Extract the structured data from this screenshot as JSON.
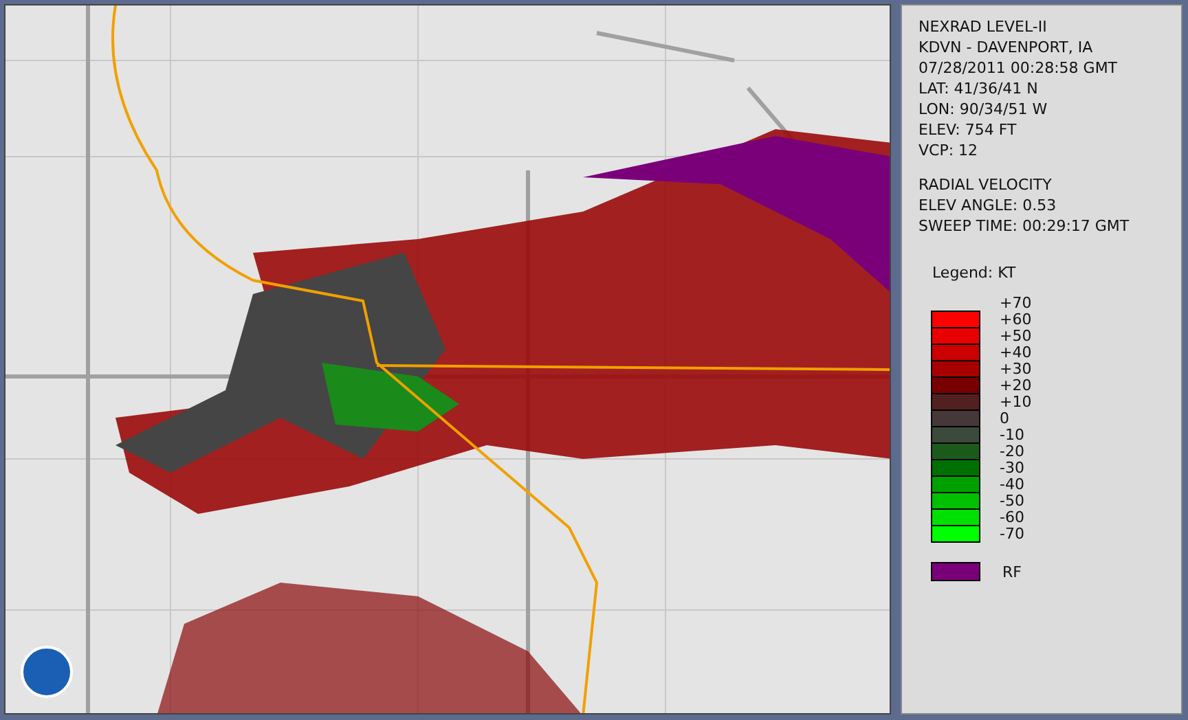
{
  "info_panel": {
    "station_lines": [
      "NEXRAD LEVEL-II",
      "KDVN - DAVENPORT, IA",
      "07/28/2011 00:28:58 GMT",
      "LAT: 41/36/41 N",
      "LON: 90/34/51 W",
      "ELEV: 754 FT",
      "VCP: 12"
    ],
    "product_lines": [
      "RADIAL VELOCITY",
      "ELEV ANGLE: 0.53",
      "SWEEP TIME: 00:29:17 GMT"
    ],
    "legend": {
      "title": "Legend: KT",
      "swatches": [
        {
          "color": "#ff0000"
        },
        {
          "color": "#e80000"
        },
        {
          "color": "#cc0000"
        },
        {
          "color": "#a80000"
        },
        {
          "color": "#780000"
        },
        {
          "color": "#522020"
        },
        {
          "color": "#463838"
        },
        {
          "color": "#3c4a3c"
        },
        {
          "color": "#1c5a1c"
        },
        {
          "color": "#007000"
        },
        {
          "color": "#00a000"
        },
        {
          "color": "#00c000"
        },
        {
          "color": "#00e000"
        },
        {
          "color": "#00ff00"
        }
      ],
      "scale_labels": [
        "+70",
        "+60",
        "+50",
        "+40",
        "+30",
        "+20",
        "+10",
        "0",
        "-10",
        "-20",
        "-30",
        "-40",
        "-50",
        "-60",
        "-70"
      ],
      "extra": [
        {
          "color": "#7a007a",
          "label": "RF"
        }
      ]
    }
  }
}
